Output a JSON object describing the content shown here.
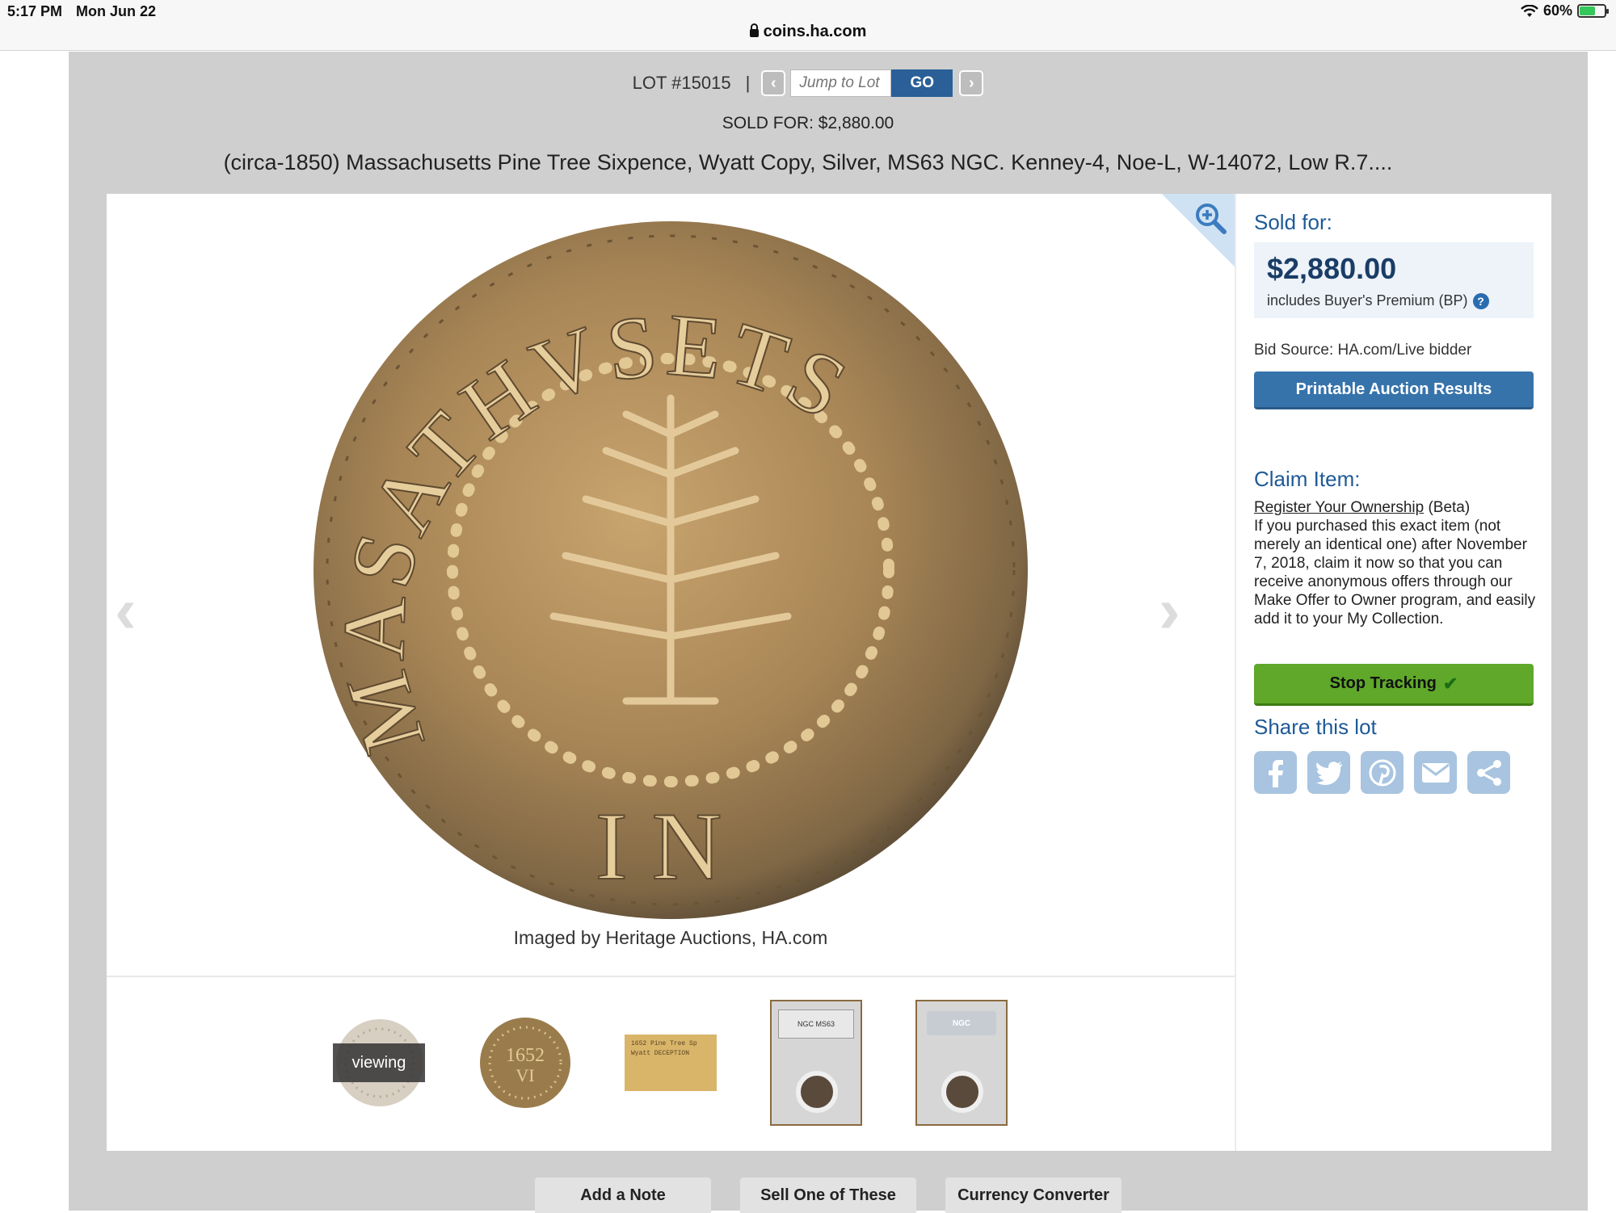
{
  "status": {
    "time": "5:17 PM",
    "date": "Mon Jun 22",
    "battery": "60%",
    "battery_level": 0.6
  },
  "browser": {
    "url": "coins.ha.com"
  },
  "lot_nav": {
    "lot_label": "LOT #15015",
    "separator": "|",
    "prev_icon": "chevron-left-icon",
    "jump_placeholder": "Jump to Lot",
    "go_label": "GO",
    "next_icon": "chevron-right-icon"
  },
  "sold_line": "SOLD FOR: $2,880.00",
  "title": "(circa-1850) Massachusetts Pine Tree Sixpence, Wyatt Copy, Silver, MS63 NGC. Kenney-4, Noe-L, W-14072, Low R.7....",
  "viewer": {
    "credit": "Imaged by Heritage Auctions, HA.com",
    "coin_legend_top": "MASATHVSETS",
    "coin_legend_bottom": "IN",
    "viewing_label": "viewing",
    "thumbnails": [
      "coin-obverse",
      "coin-reverse",
      "envelope",
      "slab-front",
      "slab-back"
    ],
    "envelope_text": [
      "1652 Pine Tree Sp",
      "Wyatt DECEPTION"
    ],
    "slab_label_front": "NGC MS63",
    "slab_label_back": "NGC"
  },
  "sidebar": {
    "sold_for_label": "Sold for:",
    "price": "$2,880.00",
    "bp_note": "includes Buyer's Premium (BP)",
    "help_icon": "?",
    "bid_source": "Bid Source: HA.com/Live bidder",
    "print_button": "Printable Auction Results",
    "claim_heading": "Claim Item:",
    "claim_link": "Register Your Ownership",
    "claim_beta": " (Beta)",
    "claim_body": "If you purchased this exact item (not merely an identical one) after November 7, 2018, claim it now so that you can receive anonymous offers through our Make Offer to Owner program, and easily add it to your My Collection.",
    "track_button": "Stop Tracking",
    "share_heading": "Share this lot",
    "share_icons": [
      "facebook-icon",
      "twitter-icon",
      "pinterest-icon",
      "email-icon",
      "share-icon"
    ]
  },
  "bottom_buttons": [
    "Add a Note",
    "Sell One of These",
    "Currency Converter"
  ],
  "colors": {
    "brand_blue": "#1f5a96",
    "button_blue": "#3673ab",
    "track_green": "#5fa82a",
    "share_blue": "#a8c4e0"
  }
}
